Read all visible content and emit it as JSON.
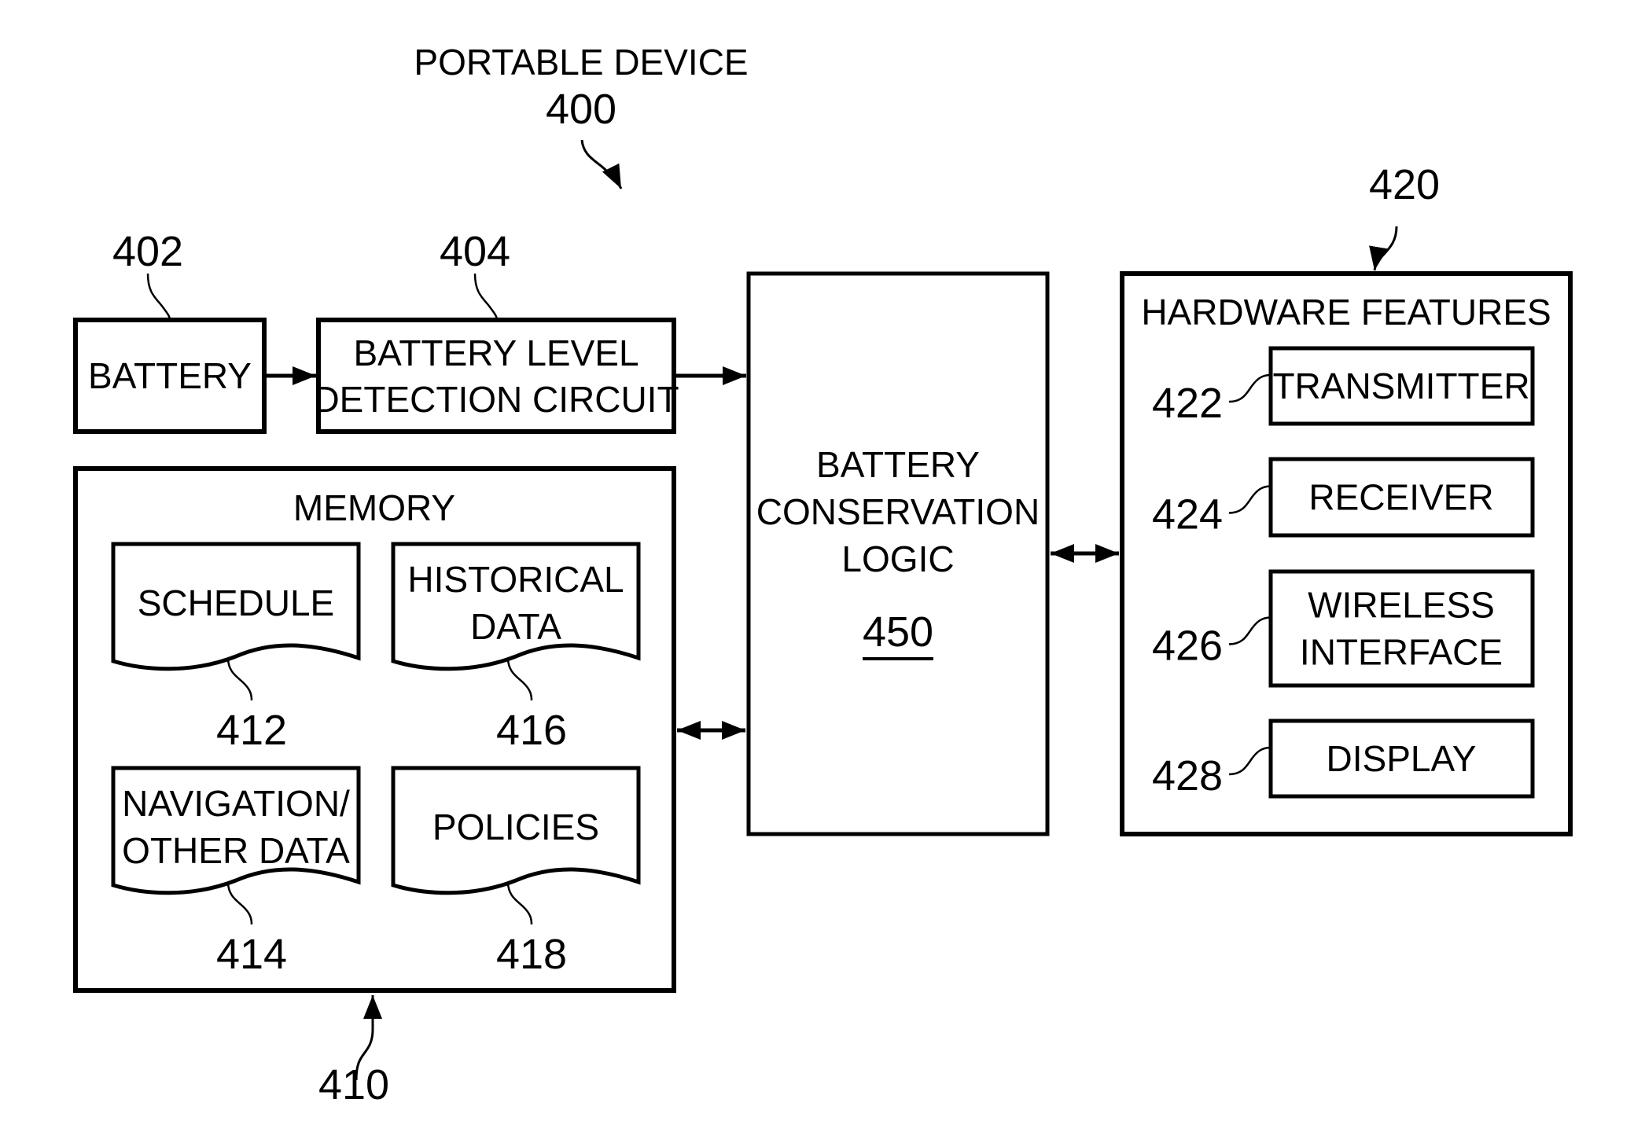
{
  "diagram": {
    "title": "PORTABLE DEVICE",
    "title_ref": "400",
    "colors": {
      "stroke": "#000000",
      "background": "#ffffff"
    },
    "battery": {
      "label": "BATTERY",
      "ref": "402"
    },
    "detection": {
      "label_lines": [
        "BATTERY LEVEL",
        "DETECTION CIRCUIT"
      ],
      "ref": "404"
    },
    "logic": {
      "label_lines": [
        "BATTERY",
        "CONSERVATION",
        "LOGIC"
      ],
      "ref": "450"
    },
    "hardware": {
      "label": "HARDWARE FEATURES",
      "ref": "420",
      "items": [
        {
          "label_lines": [
            "TRANSMITTER"
          ],
          "ref": "422"
        },
        {
          "label_lines": [
            "RECEIVER"
          ],
          "ref": "424"
        },
        {
          "label_lines": [
            "WIRELESS",
            "INTERFACE"
          ],
          "ref": "426"
        },
        {
          "label_lines": [
            "DISPLAY"
          ],
          "ref": "428"
        }
      ]
    },
    "memory": {
      "label": "MEMORY",
      "ref": "410",
      "documents": [
        {
          "label_lines": [
            "SCHEDULE"
          ],
          "ref": "412"
        },
        {
          "label_lines": [
            "HISTORICAL",
            "DATA"
          ],
          "ref": "416"
        },
        {
          "label_lines": [
            "NAVIGATION/",
            "OTHER DATA"
          ],
          "ref": "414"
        },
        {
          "label_lines": [
            "POLICIES"
          ],
          "ref": "418"
        }
      ]
    },
    "connections": [
      {
        "from": "BATTERY",
        "to": "BATTERY LEVEL DETECTION CIRCUIT",
        "direction": "one-way"
      },
      {
        "from": "BATTERY LEVEL DETECTION CIRCUIT",
        "to": "BATTERY CONSERVATION LOGIC",
        "direction": "one-way"
      },
      {
        "from": "BATTERY CONSERVATION LOGIC",
        "to": "HARDWARE FEATURES",
        "direction": "two-way"
      },
      {
        "from": "BATTERY CONSERVATION LOGIC",
        "to": "MEMORY",
        "direction": "two-way"
      }
    ]
  }
}
